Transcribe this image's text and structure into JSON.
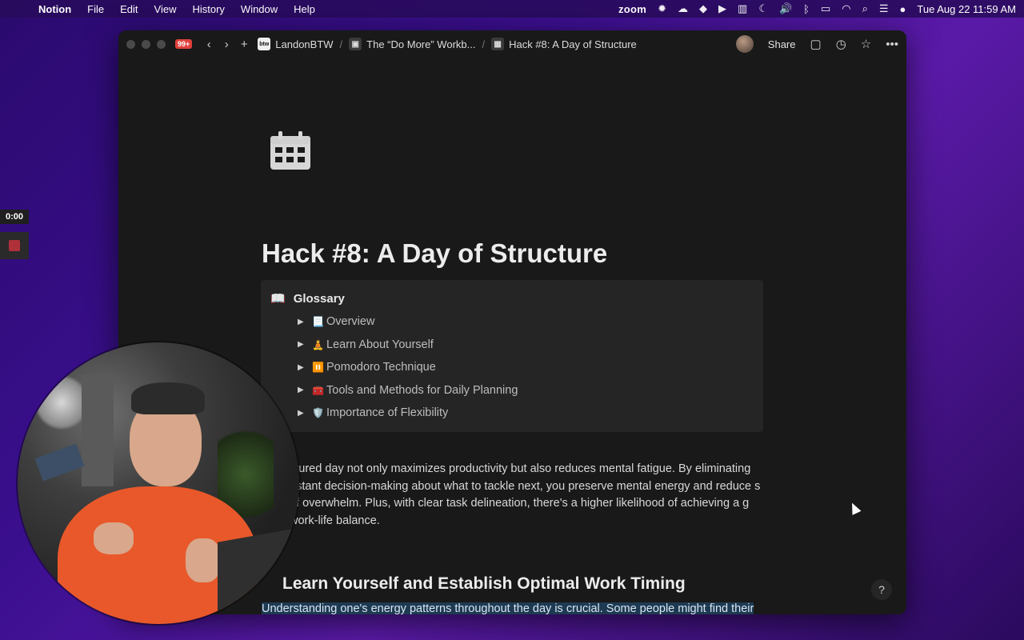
{
  "menubar": {
    "app": "Notion",
    "items": [
      "File",
      "Edit",
      "View",
      "History",
      "Window",
      "Help"
    ],
    "zoom": "zoom",
    "datetime": "Tue Aug 22  11:59 AM"
  },
  "recorder": {
    "timer": "0:00"
  },
  "window": {
    "notification_badge": "99+",
    "breadcrumbs": [
      {
        "icon_text": "btw",
        "label": "LandonBTW"
      },
      {
        "label": "The “Do More” Workb..."
      },
      {
        "label": "Hack #8: A Day of Structure"
      }
    ],
    "share_label": "Share"
  },
  "page": {
    "icon": "calendar-icon",
    "title": "Hack #8: A Day of Structure",
    "glossary": {
      "icon": "📖",
      "title": "Glossary",
      "items": [
        {
          "emoji": "📃",
          "label": "Overview"
        },
        {
          "emoji": "🧘",
          "label": "Learn  About Yourself"
        },
        {
          "emoji": "⏸️",
          "label": "Pomodoro Technique"
        },
        {
          "emoji": "🧰",
          "label": "Tools and Methods for Daily Planning"
        },
        {
          "emoji": "🛡️",
          "label": "Importance of Flexibility"
        }
      ]
    },
    "paragraph": "ctured day not only maximizes productivity but also reduces mental fatigue. By eliminating nstant decision-making about what to tackle next, you preserve mental energy and reduce s of overwhelm. Plus, with clear task delineation, there's a higher likelihood of achieving a g work-life balance.",
    "heading2": "Learn Yourself and Establish Optimal Work Timing",
    "highlighted_text": "Understanding one's energy patterns throughout the day is crucial. Some people might find their creative juices flowing in the morning, while others might be more analytical in the afternoon. By recognizing when you're at your best for certain tasks, you can optimize productivity and reduce",
    "help": "?"
  }
}
